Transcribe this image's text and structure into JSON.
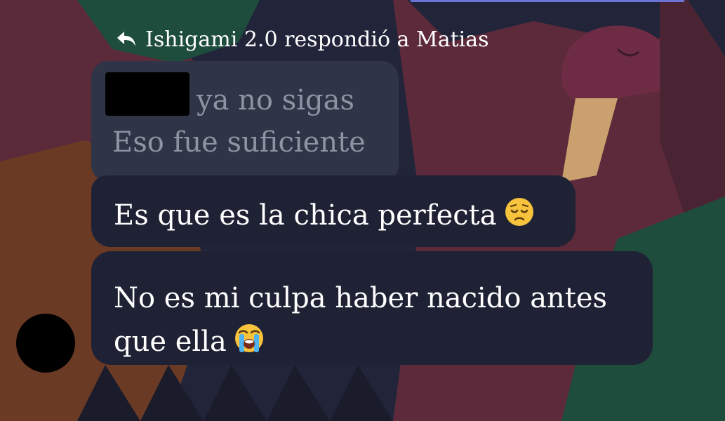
{
  "reply_header": {
    "icon": "reply-arrow-icon",
    "text": "Ishigami 2.0 respondió a Matias"
  },
  "quoted_message": {
    "redacted": true,
    "line1": "ya no sigas",
    "line2": "Eso fue suficiente"
  },
  "messages": [
    {
      "lines": [
        "Es que es la chica perfecta"
      ],
      "emoji": "pensive-face-emoji"
    },
    {
      "lines": [
        "No es mi culpa haber nacido antes",
        "que ella"
      ],
      "emoji": "loudly-crying-face-emoji"
    }
  ],
  "avatar": {
    "redacted": true
  },
  "colors": {
    "bubble": "#1f2234",
    "quoted_bubble": "#2f3447",
    "quoted_text": "#8e93a3",
    "text": "#ffffff",
    "wallpaper_maroon": "#5c2a3a",
    "wallpaper_green": "#1f4d3d",
    "wallpaper_navy": "#22253a",
    "wallpaper_orange": "#6b3a25"
  }
}
